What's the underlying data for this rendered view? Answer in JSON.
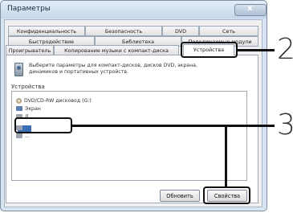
{
  "window": {
    "title": "Параметры"
  },
  "tabs_row1": [
    {
      "label": "Конфиденциальность"
    },
    {
      "label": "Безопасность"
    },
    {
      "label": "DVD"
    },
    {
      "label": "Сеть"
    }
  ],
  "tabs_row2": [
    {
      "label": "Быстродействие"
    },
    {
      "label": "Библиотека"
    },
    {
      "label": "Подключаемые модули"
    }
  ],
  "tabs_row3": [
    {
      "label": "Проигрыватель"
    },
    {
      "label": "Копирование музыки с компакт-диска"
    },
    {
      "label": "Устройства"
    }
  ],
  "description": {
    "line1": "Выберите параметры для компакт-дисков, дисков DVD, экрана,",
    "line2": "динамиков и портативных устройств."
  },
  "devices": {
    "group_label": "Устройства",
    "items": [
      {
        "label": "DVD/CD-RW дисковод (G:)",
        "icon": "disc-drive-icon"
      },
      {
        "label": "Экран",
        "icon": "monitor-icon"
      },
      {
        "label": "Д...",
        "icon": "speaker-icon"
      },
      {
        "label": "",
        "icon": "portable-device-icon"
      },
      {
        "label": "...",
        "icon": "device-icon"
      }
    ]
  },
  "buttons": {
    "refresh": "Обновить",
    "properties": "Свойства"
  },
  "callouts": [
    {
      "number": "2"
    },
    {
      "number": "3"
    }
  ],
  "colors": {
    "selection": "#3b6fb5",
    "callout": "#111111",
    "chrome": "#d7e4f2"
  }
}
